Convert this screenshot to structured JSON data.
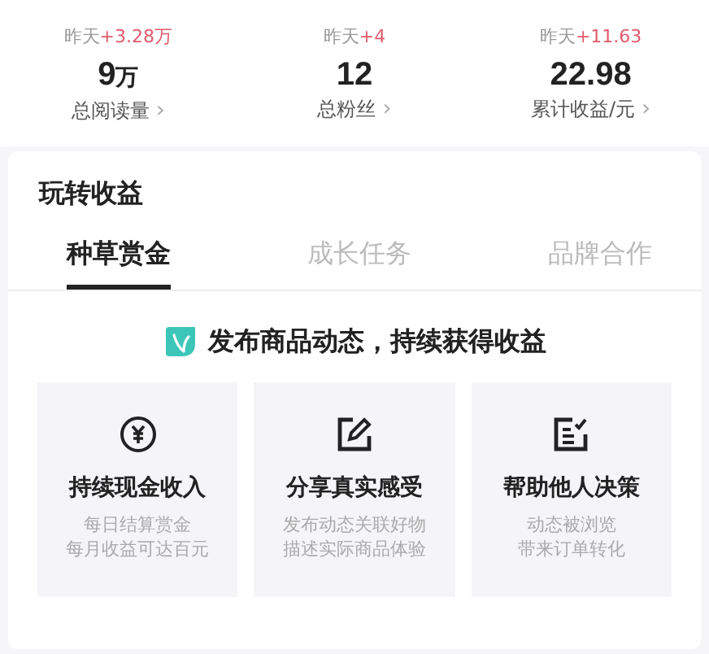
{
  "stats": [
    {
      "delta_label": "昨天",
      "delta": "+3.28万",
      "value": "9",
      "unit": "万",
      "label": "总阅读量",
      "arrow": "›"
    },
    {
      "delta_label": "昨天",
      "delta": "+4",
      "value": "12",
      "label": "总粉丝",
      "arrow": "›"
    },
    {
      "delta_label": "昨天",
      "delta": "+11.63",
      "value": "22.98",
      "label": "累计收益/元",
      "arrow": "›"
    }
  ],
  "section": {
    "title": "玩转收益",
    "tabs": [
      {
        "label": "种草赏金",
        "selected": true
      },
      {
        "label": "成长任务",
        "selected": false
      },
      {
        "label": "品牌合作",
        "selected": false
      }
    ],
    "headline": "发布商品动态，持续获得收益",
    "features": [
      {
        "kind": "yuan",
        "title": "持续现金收入",
        "lines": [
          "每日结算赏金",
          "每月收益可达百元"
        ]
      },
      {
        "kind": "edit",
        "title": "分享真实感受",
        "lines": [
          "发布动态关联好物",
          "描述实际商品体验"
        ]
      },
      {
        "kind": "checklist",
        "title": "帮助他人决策",
        "lines": [
          "动态被浏览",
          "带来订单转化"
        ]
      }
    ]
  }
}
